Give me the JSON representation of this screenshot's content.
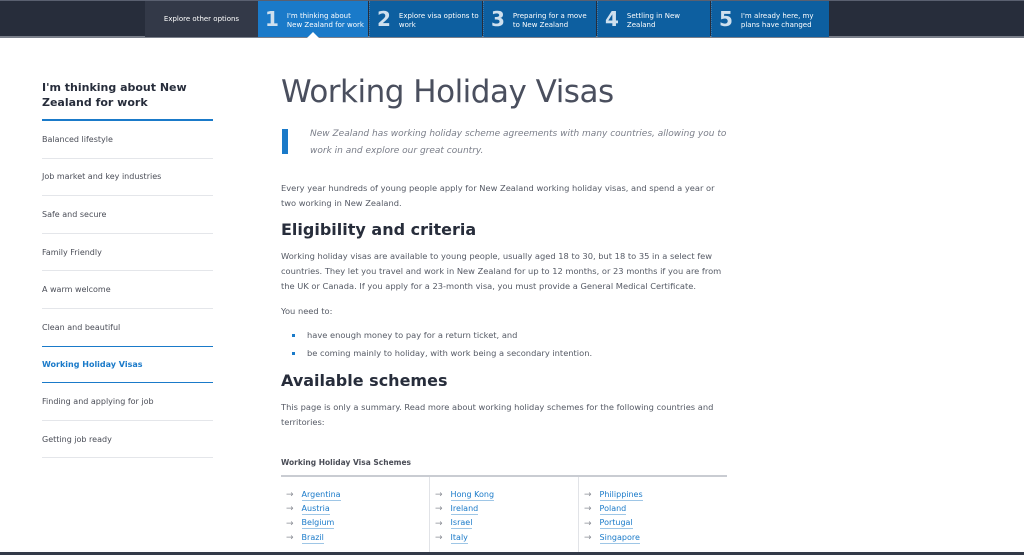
{
  "topnav": {
    "explore_label": "Explore other options",
    "steps": [
      {
        "number": "1",
        "label": "I'm thinking about New Zealand for work",
        "active": true
      },
      {
        "number": "2",
        "label": "Explore visa options to work",
        "active": false
      },
      {
        "number": "3",
        "label": "Preparing for a move to New Zealand",
        "active": false
      },
      {
        "number": "4",
        "label": "Settling in New Zealand",
        "active": false
      },
      {
        "number": "5",
        "label": "I'm already here, my plans have changed",
        "active": false
      }
    ]
  },
  "sidebar": {
    "title": "I'm thinking about New Zealand for work",
    "items": [
      {
        "label": "Balanced lifestyle"
      },
      {
        "label": "Job market and key industries"
      },
      {
        "label": "Safe and secure"
      },
      {
        "label": "Family Friendly"
      },
      {
        "label": "A warm welcome"
      },
      {
        "label": "Clean and beautiful"
      },
      {
        "label": "Working Holiday Visas",
        "active": true
      },
      {
        "label": "Finding and applying for job"
      },
      {
        "label": "Getting job ready"
      }
    ]
  },
  "main": {
    "title": "Working Holiday Visas",
    "intro": "New Zealand has working holiday scheme agreements with many countries, allowing you to work in and explore our great country.",
    "paragraph1": "Every year hundreds of young people apply for New Zealand working holiday visas, and spend a year or two working in New Zealand.",
    "eligibility_heading": "Eligibility and criteria",
    "eligibility_text": "Working holiday visas are available to young people, usually aged 18 to 30, but 18 to 35 in a select few countries. They let you travel and work in New Zealand for up to 12 months, or 23 months if you are from the UK or Canada. If you apply for a 23-month visa, you must provide a General Medical Certificate.",
    "need_to": "You need to:",
    "needs": [
      "have enough money to pay for a return ticket, and",
      "be coming mainly to holiday, with work being a secondary intention."
    ],
    "schemes_heading": "Available schemes",
    "schemes_text": "This page is only a summary. Read more about working holiday schemes for the following countries and territories:",
    "schemes_table_title": "Working Holiday Visa Schemes",
    "arrow_icon": "→",
    "columns": [
      [
        "Argentina",
        "Austria",
        "Belgium",
        "Brazil"
      ],
      [
        "Hong Kong",
        "Ireland",
        "Israel",
        "Italy"
      ],
      [
        "Philippines",
        "Poland",
        "Portugal",
        "Singapore"
      ]
    ]
  },
  "colors": {
    "accent": "#1a7ac9",
    "nav_dark": "#272d3b",
    "nav_step": "#0d5fa0"
  }
}
